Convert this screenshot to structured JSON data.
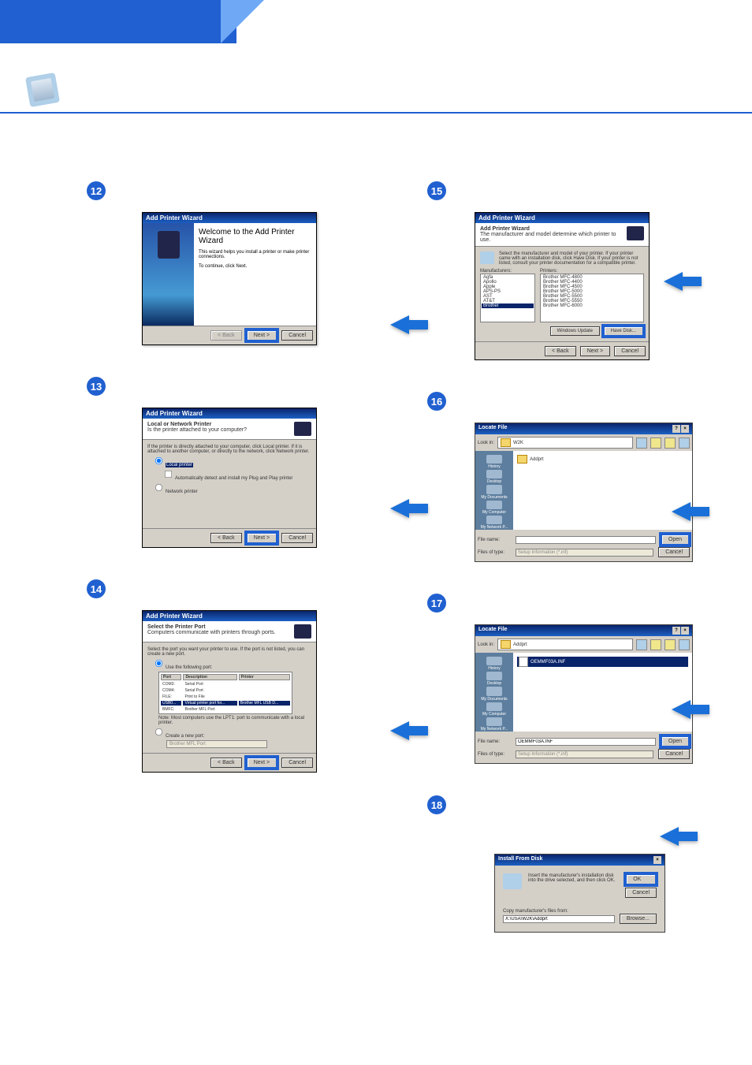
{
  "steps": {
    "s12": {
      "title": "Add Printer Wizard",
      "welcome": "Welcome to the Add Printer Wizard",
      "line1": "This wizard helps you install a printer or make printer connections.",
      "line2": "To continue, click Next.",
      "back": "< Back",
      "next": "Next >",
      "cancel": "Cancel"
    },
    "s13": {
      "title": "Add Printer Wizard",
      "heading": "Local or Network Printer",
      "sub": "Is the printer attached to your computer?",
      "desc": "If the printer is directly attached to your computer, click Local printer. If it is attached to another computer, or directly to the network, click Network printer.",
      "opt1": "Local printer",
      "opt1chk": "Automatically detect and install my Plug and Play printer",
      "opt2": "Network printer",
      "back": "< Back",
      "next": "Next >",
      "cancel": "Cancel"
    },
    "s14": {
      "title": "Add Printer Wizard",
      "heading": "Select the Printer Port",
      "sub": "Computers communicate with printers through ports.",
      "desc": "Select the port you want your printer to use. If the port is not listed, you can create a new port.",
      "opt1": "Use the following port:",
      "cols": [
        "Port",
        "Description",
        "Printer"
      ],
      "rows": [
        [
          "COM3:",
          "Serial Port",
          ""
        ],
        [
          "COM4:",
          "Serial Port",
          ""
        ],
        [
          "FILE:",
          "Print to File",
          ""
        ],
        [
          "USB0...",
          "Virtual printer port for...",
          "Brother MFL USB D..."
        ],
        [
          "BMFC:",
          "Brother MFL Port",
          ""
        ]
      ],
      "note": "Note: Most computers use the LPT1: port to communicate with a local printer.",
      "opt2": "Create a new port:",
      "opt2type": "Brother MFL Port",
      "back": "< Back",
      "next": "Next >",
      "cancel": "Cancel"
    },
    "s15": {
      "title": "Add Printer Wizard",
      "heading": "Add Printer Wizard",
      "sub": "The manufacturer and model determine which printer to use.",
      "desc": "Select the manufacturer and model of your printer. If your printer came with an installation disk, click Have Disk. If your printer is not listed, consult your printer documentation for a compatible printer.",
      "mfg_label": "Manufacturers:",
      "printers_label": "Printers:",
      "mfgs": [
        "Agfa",
        "Apollo",
        "Apple",
        "APS-PS",
        "AST",
        "AT&T",
        "Brother"
      ],
      "printers": [
        "Brother MFC-4800",
        "Brother MFC-4400",
        "Brother MFC-4500",
        "Brother MFC-5000",
        "Brother MFC-5500",
        "Brother MFC-5550",
        "Brother MFC-6000"
      ],
      "winupdate": "Windows Update",
      "havedisk": "Have Disk...",
      "back": "< Back",
      "next": "Next >",
      "cancel": "Cancel"
    },
    "s16": {
      "title": "Locate File",
      "lookin": "Look in:",
      "folder": "W2K",
      "item": "Addprt",
      "fn_label": "File name:",
      "fn": "",
      "ft_label": "Files of type:",
      "ft": "Setup Information (*.inf)",
      "open": "Open",
      "cancel": "Cancel",
      "side": [
        "History",
        "Desktop",
        "My Documents",
        "My Computer",
        "My Network P..."
      ]
    },
    "s17": {
      "title": "Locate File",
      "lookin": "Look in:",
      "folder": "Addprt",
      "item": "OEMMF03A.INF",
      "fn_label": "File name:",
      "fn": "OEMMF03A.INF",
      "ft_label": "Files of type:",
      "ft": "Setup Information (*.inf)",
      "open": "Open",
      "cancel": "Cancel",
      "side": [
        "History",
        "Desktop",
        "My Documents",
        "My Computer",
        "My Network P..."
      ]
    },
    "s18": {
      "title": "Install From Disk",
      "msg": "Insert the manufacturer's installation disk into the drive selected, and then click OK.",
      "ok": "OK",
      "cancel": "Cancel",
      "copy_label": "Copy manufacturer's files from:",
      "path": "X:\\USA\\W2K\\Addprt",
      "browse": "Browse..."
    }
  }
}
